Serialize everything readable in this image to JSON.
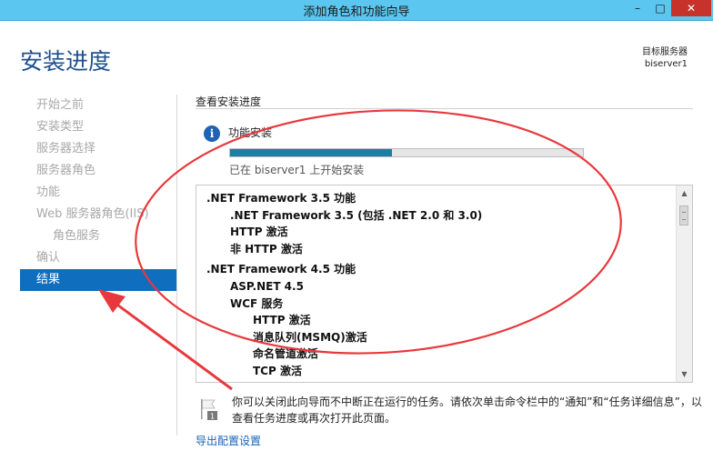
{
  "window": {
    "title": "添加角色和功能向导",
    "minimize_glyph": "–",
    "maximize_glyph": "□",
    "close_glyph": "✕"
  },
  "header": {
    "title": "安装进度",
    "server_label": "目标服务器",
    "server_name": "biserver1"
  },
  "nav": {
    "items": [
      {
        "label": "开始之前",
        "active": false
      },
      {
        "label": "安装类型",
        "active": false
      },
      {
        "label": "服务器选择",
        "active": false
      },
      {
        "label": "服务器角色",
        "active": false
      },
      {
        "label": "功能",
        "active": false
      },
      {
        "label": "Web 服务器角色(IIS)",
        "active": false
      },
      {
        "label": "角色服务",
        "active": false
      },
      {
        "label": "确认",
        "active": false
      },
      {
        "label": "结果",
        "active": true
      }
    ]
  },
  "main": {
    "section_label": "查看安装进度",
    "feature_label": "功能安装",
    "progress_fraction": 0.46,
    "progress_text": "已在 biserver1 上开始安装",
    "results": [
      ".NET Framework 3.5 功能",
      ".NET Framework 3.5 (包括 .NET 2.0 和 3.0)",
      "HTTP 激活",
      "非 HTTP 激活",
      ".NET Framework 4.5 功能",
      "ASP.NET 4.5",
      "WCF 服务",
      "HTTP 激活",
      "消息队列(MSMQ)激活",
      "命名管道激活",
      "TCP 激活"
    ],
    "note_line1": "你可以关闭此向导而不中断正在运行的任务。请依次单击命令栏中的“通知”和“任务详细信息”，以",
    "note_line2": "查看任务进度或再次打开此页面。",
    "export_link": "导出配置设置"
  },
  "colors": {
    "titlebar": "#5bc6f0",
    "accent": "#106ebe",
    "header_text": "#1f4f8e",
    "annotation": "#e8383d"
  },
  "icons": {
    "info": "info-icon",
    "flag": "flag-icon",
    "scroll_up": "arrow-up-icon",
    "scroll_down": "arrow-down-icon"
  }
}
